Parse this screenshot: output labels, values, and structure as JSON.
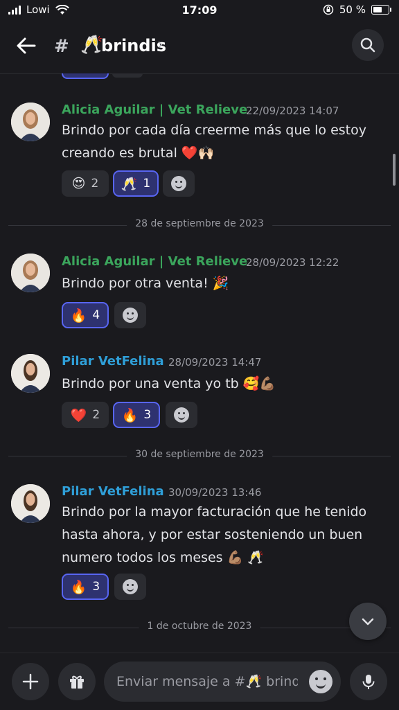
{
  "status_bar": {
    "carrier": "Lowi",
    "time": "17:09",
    "battery": "50 %"
  },
  "channel": {
    "hash": "#",
    "emoji": "🥂",
    "name": "brindis",
    "chevron": "›"
  },
  "messages": [
    {
      "author": "Alicia Aguilar | Vet Relieve",
      "author_color": "#3ba55c",
      "timestamp": "22/09/2023 14:07",
      "text": "Brindo por cada día creerme más que lo estoy creando es brutal ❤️🙌🏻",
      "reactions": [
        {
          "emoji": "😍",
          "count": "2",
          "selected": false
        },
        {
          "emoji": "🥂",
          "count": "1",
          "selected": true
        }
      ]
    },
    {
      "author": "Alicia Aguilar | Vet Relieve",
      "author_color": "#3ba55c",
      "timestamp": "28/09/2023 12:22",
      "text": "Brindo por otra venta! 🎉",
      "reactions": [
        {
          "emoji": "🔥",
          "count": "4",
          "selected": true
        }
      ]
    },
    {
      "author": "Pilar VetFelina",
      "author_color": "#2f9fd8",
      "timestamp": "28/09/2023 14:47",
      "text": "Brindo por una venta yo tb 🥰💪🏽",
      "reactions": [
        {
          "emoji": "❤️",
          "count": "2",
          "selected": false
        },
        {
          "emoji": "🔥",
          "count": "3",
          "selected": true
        }
      ]
    },
    {
      "author": "Pilar VetFelina",
      "author_color": "#2f9fd8",
      "timestamp": "30/09/2023 13:46",
      "text": "Brindo por la mayor facturación que he tenido hasta ahora, y por estar sosteniendo un buen numero todos los meses 💪🏽 🥂",
      "reactions": [
        {
          "emoji": "🔥",
          "count": "3",
          "selected": true
        }
      ]
    }
  ],
  "date_dividers": [
    "28 de septiembre de 2023",
    "30 de septiembre de 2023",
    "1 de octubre de 2023"
  ],
  "composer": {
    "placeholder": "Enviar mensaje a #🥂 brindis"
  },
  "icons": [
    "back-arrow-icon",
    "search-icon",
    "add-reaction-icon",
    "plus-icon",
    "gift-icon",
    "emoji-icon",
    "microphone-icon",
    "chevron-down-icon"
  ],
  "colors": {
    "background": "#1a1a1e",
    "accent": "#5865f2",
    "green_role": "#3ba55c",
    "blue_role": "#2f9fd8"
  }
}
